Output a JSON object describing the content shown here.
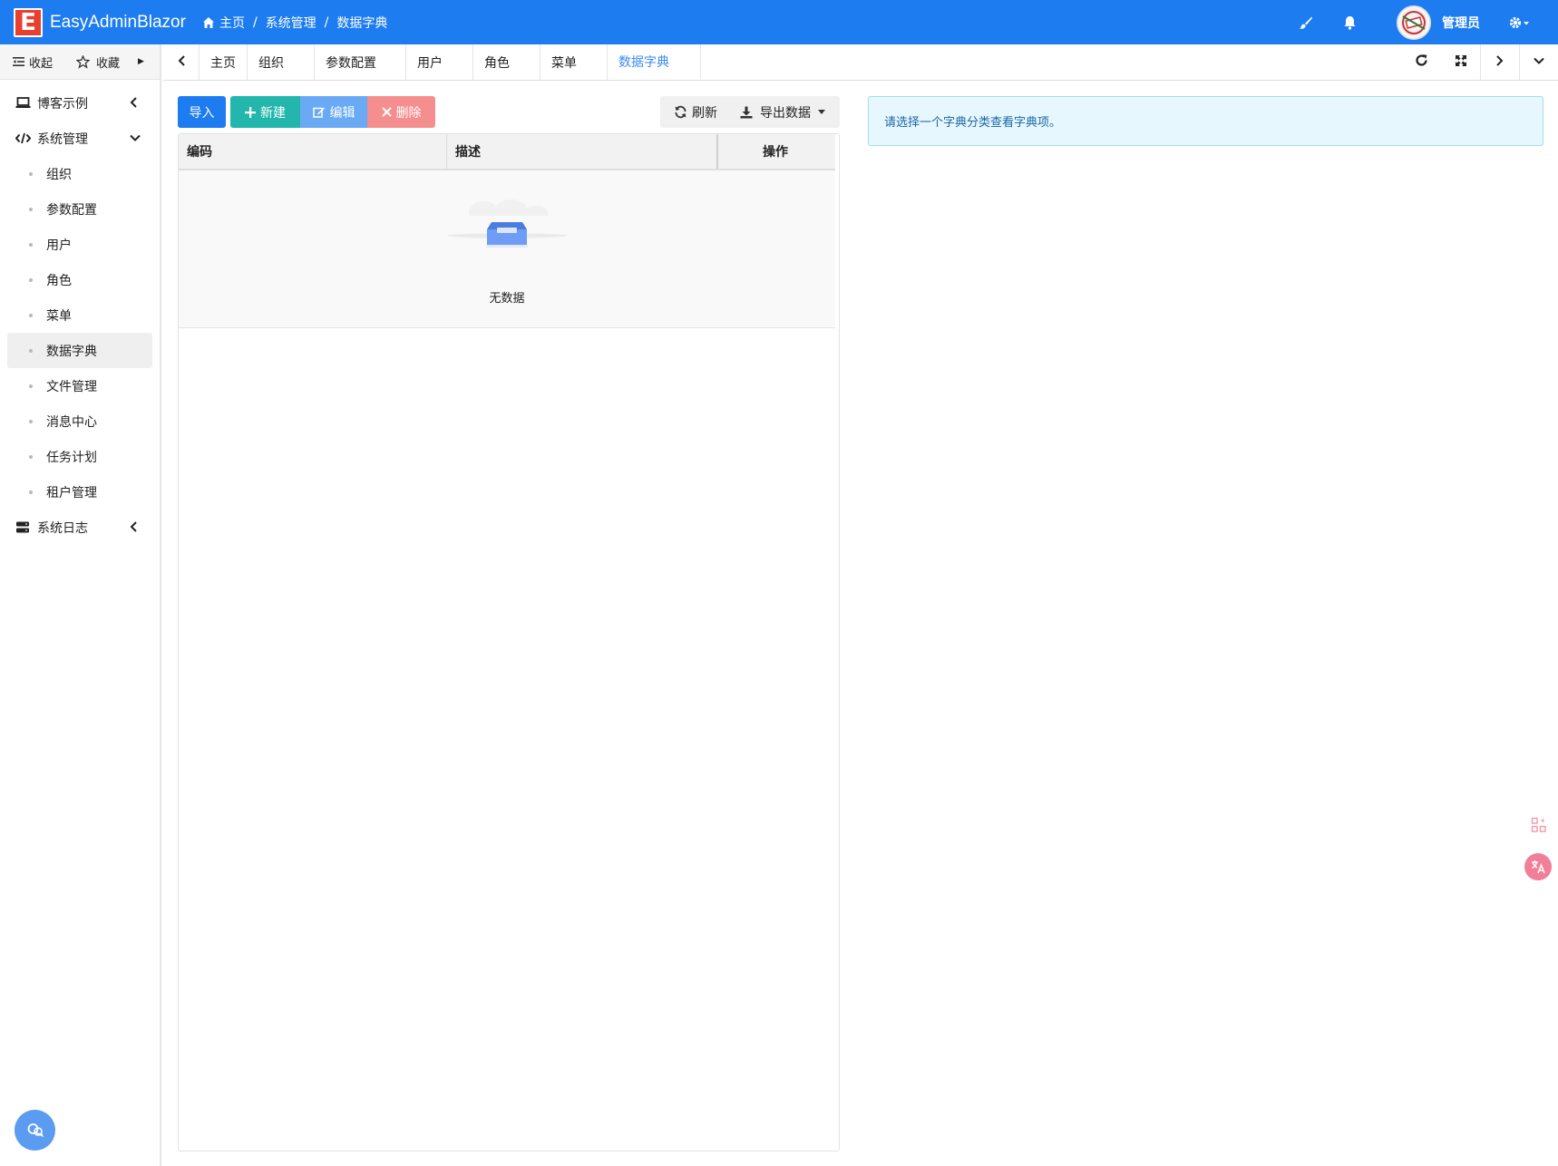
{
  "app": {
    "logo_letter": "E",
    "title": "EasyAdminBlazor"
  },
  "breadcrumb": {
    "home": "主页",
    "sep": "/",
    "level1": "系统管理",
    "level2": "数据字典"
  },
  "user": {
    "name": "管理员"
  },
  "sidebar": {
    "collapse_label": "收起",
    "favorites_label": "收藏",
    "groups": {
      "blog": "博客示例",
      "system": "系统管理",
      "logs": "系统日志"
    },
    "items": [
      "组织",
      "参数配置",
      "用户",
      "角色",
      "菜单",
      "数据字典",
      "文件管理",
      "消息中心",
      "任务计划",
      "租户管理"
    ]
  },
  "tabs": [
    "主页",
    "组织",
    "参数配置",
    "用户",
    "角色",
    "菜单",
    "数据字典"
  ],
  "toolbar": {
    "import": "导入",
    "new": "新建",
    "edit": "编辑",
    "delete": "删除",
    "refresh": "刷新",
    "export": "导出数据"
  },
  "table": {
    "columns": [
      "编码",
      "描述",
      "操作"
    ],
    "empty_text": "无数据"
  },
  "alert": {
    "text": "请选择一个字典分类查看字典项。"
  },
  "colors": {
    "topbar": "#1c7cf0",
    "import": "#1c7cf0",
    "new": "#23b6ac",
    "edit": "#6aaaf5",
    "delete": "#f58f8f",
    "tab_active": "#3b8cf1"
  }
}
